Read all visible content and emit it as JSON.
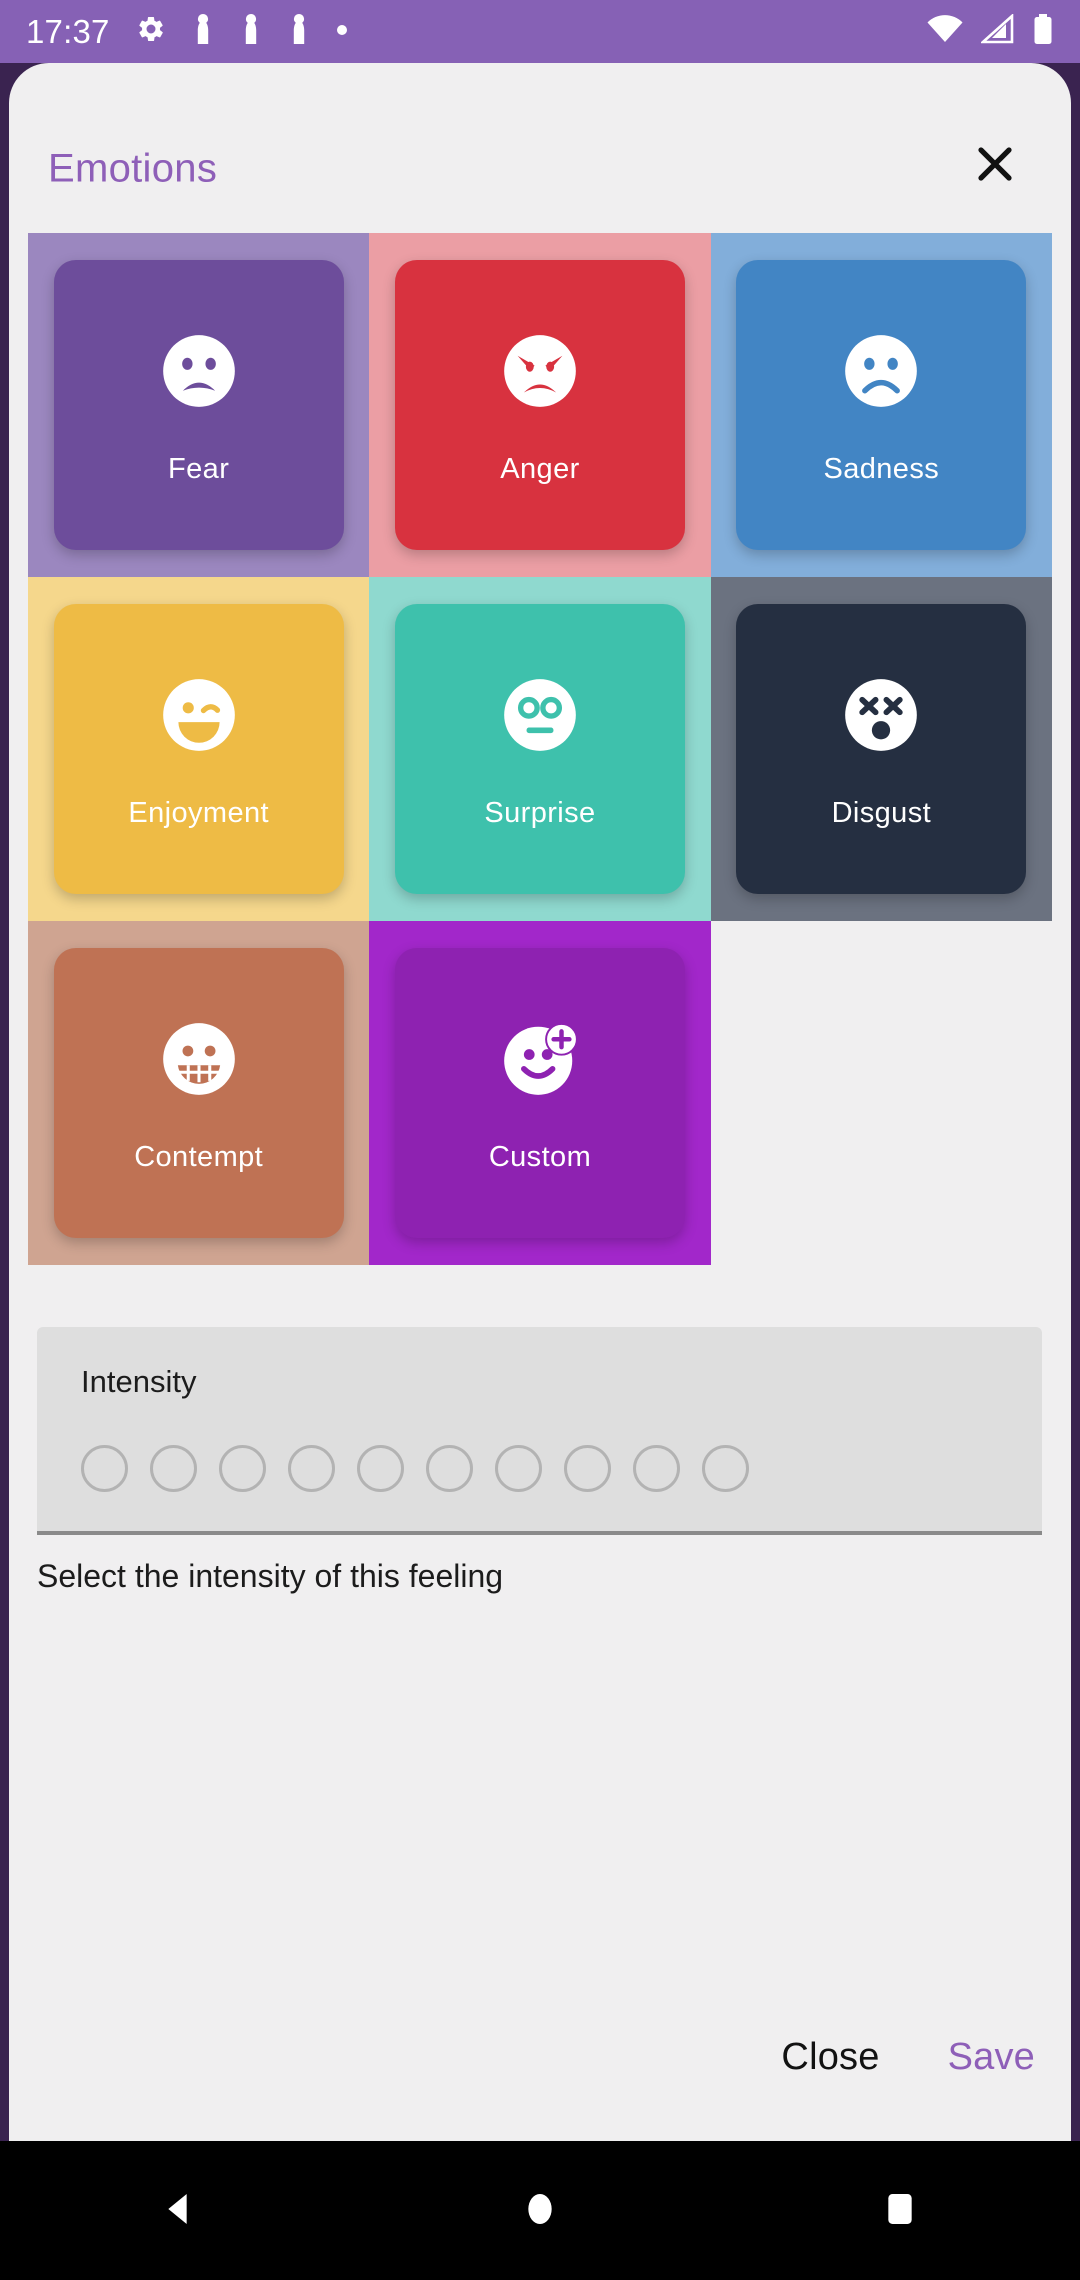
{
  "status_bar": {
    "time": "17:37",
    "left_icons": [
      "gear-icon",
      "notification-icon",
      "notification-icon",
      "notification-icon",
      "dot-icon"
    ],
    "right_icons": [
      "wifi-icon",
      "cellular-signal-icon",
      "battery-icon"
    ],
    "background_color": "#8661b5"
  },
  "dialog": {
    "title": "Emotions",
    "title_color": "#8e5fb8",
    "background_color": "#f0eff0",
    "close_icon": "close-icon"
  },
  "emotions": [
    {
      "label": "Fear",
      "icon": "fearful-face-icon",
      "tile_color": "#9b87bf",
      "card_color": "#6d4d9b"
    },
    {
      "label": "Anger",
      "icon": "angry-face-icon",
      "tile_color": "#eb9ea4",
      "card_color": "#d8323f"
    },
    {
      "label": "Sadness",
      "icon": "sad-face-icon",
      "tile_color": "#82aeda",
      "card_color": "#4285c4"
    },
    {
      "label": "Enjoyment",
      "icon": "winking-face-icon",
      "tile_color": "#f5d78c",
      "card_color": "#eebb45"
    },
    {
      "label": "Surprise",
      "icon": "surprised-face-icon",
      "tile_color": "#8fd9cf",
      "card_color": "#3ec1ac"
    },
    {
      "label": "Disgust",
      "icon": "dizzy-face-icon",
      "tile_color": "#6b7280",
      "card_color": "#252f41"
    },
    {
      "label": "Contempt",
      "icon": "grimacing-face-icon",
      "tile_color": "#cfa491",
      "card_color": "#bf7254"
    },
    {
      "label": "Custom",
      "icon": "add-emotion-icon",
      "tile_color": "#a227ca",
      "card_color": "#8e22b1"
    }
  ],
  "intensity": {
    "label": "Intensity",
    "helper_text": "Select the intensity of this feeling",
    "option_count": 10,
    "selected": null,
    "field_background": "#dedede"
  },
  "actions": {
    "close_label": "Close",
    "save_label": "Save",
    "save_color": "#8e5fb8",
    "close_color": "#121212"
  },
  "nav_bar": {
    "back": "back-triangle-icon",
    "home": "home-circle-icon",
    "recents": "recents-square-icon"
  }
}
